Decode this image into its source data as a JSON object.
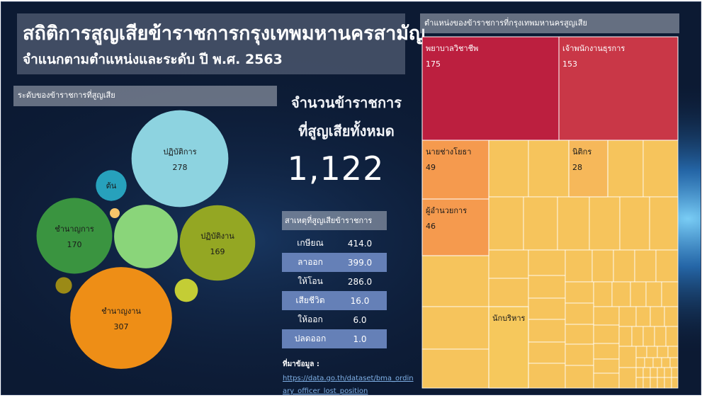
{
  "title": "สถิติการสูญเสียข้าราชการกรุงเทพมหานครสามัญ",
  "subtitle": "จำแนกตามตำแหน่งและระดับ ปี พ.ศ. 2563",
  "colors": {
    "background": "#0c1a33",
    "accent_link": "#7fb0e6",
    "table_alt_row": "#6580b7"
  },
  "total": {
    "label_line1": "จำนวนข้าราชการ",
    "label_line2": "ที่สูญเสียทั้งหมด",
    "value": "1,122"
  },
  "causes": {
    "header": "สาเหตุที่สูญเสียข้าราชการ",
    "rows": [
      {
        "name": "เกษียณ",
        "value": "414.0"
      },
      {
        "name": "ลาออก",
        "value": "399.0"
      },
      {
        "name": "ให้โอน",
        "value": "286.0"
      },
      {
        "name": "เสียชีวิต",
        "value": "16.0"
      },
      {
        "name": "ให้ออก",
        "value": "6.0"
      },
      {
        "name": "ปลดออก",
        "value": "1.0"
      }
    ]
  },
  "source": {
    "label": "ที่มาข้อมูล :",
    "url": "https://data.go.th/dataset/bma_ordinary_officer_lost_position"
  },
  "chart_data": [
    {
      "type": "bubble",
      "title": "ระดับของข้าราชการที่สูญเสีย",
      "bubbles": [
        {
          "name": "ปฏิบัติการ",
          "value": 278,
          "label": "278",
          "color": "#8dd3e0"
        },
        {
          "name": "ชำนาญงาน",
          "value": 307,
          "label": "307",
          "color": "#ee8e16"
        },
        {
          "name": "ชำนาญการ",
          "value": 170,
          "label": "170",
          "color": "#3a9440"
        },
        {
          "name": "ปฏิบัติงาน",
          "value": 169,
          "label": "169",
          "color": "#94a723"
        },
        {
          "name": "",
          "value": 120,
          "label": "",
          "color": "#8ad57a"
        },
        {
          "name": "ต้น",
          "value": 28,
          "label": "",
          "color": "#27a1bc"
        },
        {
          "name": "",
          "value": 16,
          "label": "",
          "color": "#c4cd35"
        },
        {
          "name": "",
          "value": 8,
          "label": "",
          "color": "#9b8a16"
        },
        {
          "name": "",
          "value": 2,
          "label": "",
          "color": "#f9c56a"
        }
      ]
    },
    {
      "type": "treemap",
      "title": "ตำแหน่งของข้าราชการที่กรุงเทพมหานครสูญเสีย",
      "items": [
        {
          "name": "พยาบาลวิชาชีพ",
          "value": 175,
          "label": "175",
          "color": "#bc1f3f"
        },
        {
          "name": "เจ้าพนักงานธุรการ",
          "value": 153,
          "label": "153",
          "color": "#c93747"
        },
        {
          "name": "นายช่างโยธา",
          "value": 49,
          "label": "49",
          "color": "#f59a4e"
        },
        {
          "name": "ผู้อำนวยการ",
          "value": 46,
          "label": "46",
          "color": "#f59a4e"
        },
        {
          "name": "นิติกร",
          "value": 28,
          "label": "28",
          "color": "#f6b85a"
        },
        {
          "name": "นักบริหาร",
          "value": null,
          "label": "",
          "color": "#f6c85c"
        }
      ]
    }
  ]
}
